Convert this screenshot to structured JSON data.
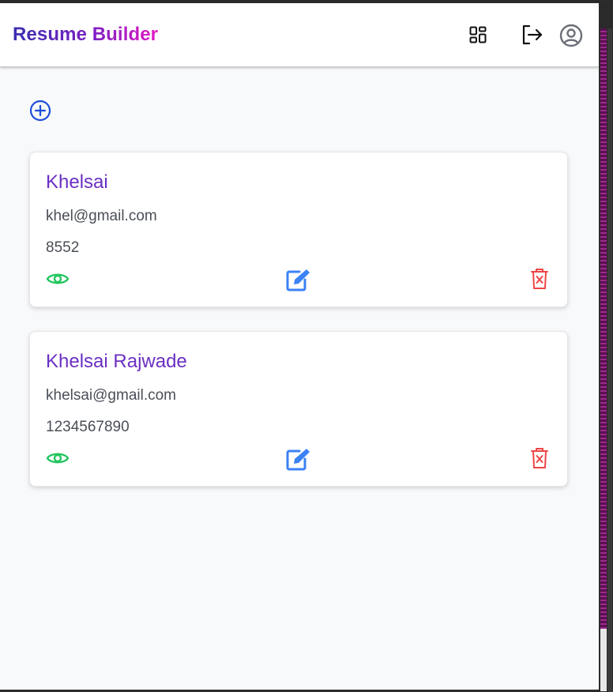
{
  "header": {
    "brand": "Resume Builder",
    "icons": [
      "dashboard-icon",
      "logout-icon",
      "user-circle-icon"
    ]
  },
  "add_button": {
    "icon": "plus-circle-icon"
  },
  "colors": {
    "brand_start": "#3a2fb0",
    "brand_end": "#e21bc4",
    "name": "#6b2fc3",
    "view": "#22c55e",
    "edit": "#3b82f6",
    "delete": "#ef4444"
  },
  "resumes": [
    {
      "name": "Khelsai",
      "email": "khel@gmail.com",
      "phone": "8552"
    },
    {
      "name": "Khelsai Rajwade",
      "email": "khelsai@gmail.com",
      "phone": "1234567890"
    }
  ]
}
